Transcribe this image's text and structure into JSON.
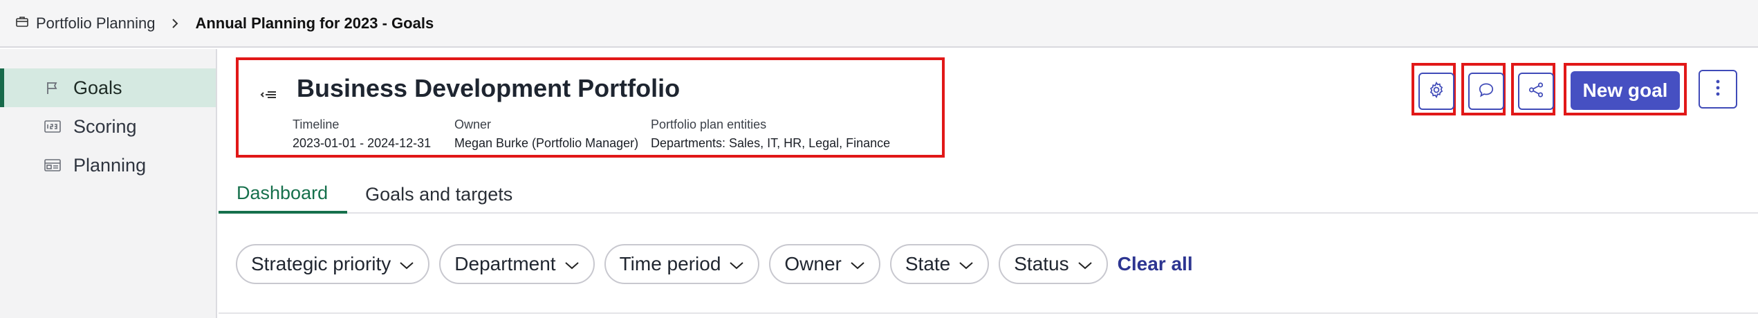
{
  "breadcrumb": {
    "home_label": "Portfolio Planning",
    "current_label": "Annual Planning for 2023 - Goals"
  },
  "sidebar": {
    "items": [
      {
        "label": "Goals",
        "icon": "flag-icon",
        "active": true
      },
      {
        "label": "Scoring",
        "icon": "scoring-icon",
        "active": false
      },
      {
        "label": "Planning",
        "icon": "planning-icon",
        "active": false
      }
    ]
  },
  "header": {
    "title": "Business Development Portfolio",
    "meta": {
      "timeline_label": "Timeline",
      "timeline_value": "2023-01-01 - 2024-12-31",
      "owner_label": "Owner",
      "owner_value": "Megan Burke (Portfolio Manager)",
      "entities_label": "Portfolio plan entities",
      "entities_value": "Departments: Sales, IT, HR, Legal, Finance"
    }
  },
  "actions": {
    "settings_icon": "gear-icon",
    "comment_icon": "comment-icon",
    "share_icon": "share-icon",
    "new_goal_label": "New goal",
    "more_icon": "more-vertical-icon"
  },
  "tabs": [
    {
      "label": "Dashboard",
      "active": true
    },
    {
      "label": "Goals and targets",
      "active": false
    }
  ],
  "filters": {
    "chips": [
      {
        "label": "Strategic priority"
      },
      {
        "label": "Department"
      },
      {
        "label": "Time period"
      },
      {
        "label": "Owner"
      },
      {
        "label": "State"
      },
      {
        "label": "Status"
      }
    ],
    "clear_all_label": "Clear all"
  },
  "colors": {
    "accent": "#4650c2",
    "active_tab": "#16704c",
    "sidebar_active_bg": "#d5e9e1",
    "highlight_border": "#e11818"
  }
}
